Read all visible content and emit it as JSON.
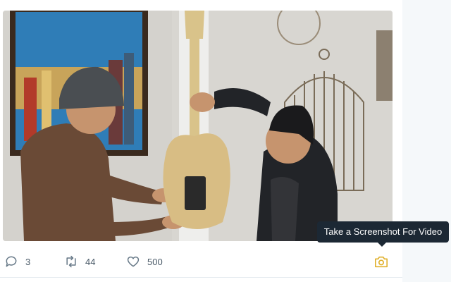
{
  "tweet": {
    "actions": {
      "reply_count": "3",
      "retweet_count": "44",
      "like_count": "500"
    },
    "video_toolbar": {
      "screenshot_icon": "camera-icon",
      "tooltip": "Take a Screenshot For Video"
    }
  },
  "colors": {
    "action_gray": "#657786",
    "camera_accent": "#e0b12e",
    "tooltip_bg": "#1c2834"
  }
}
